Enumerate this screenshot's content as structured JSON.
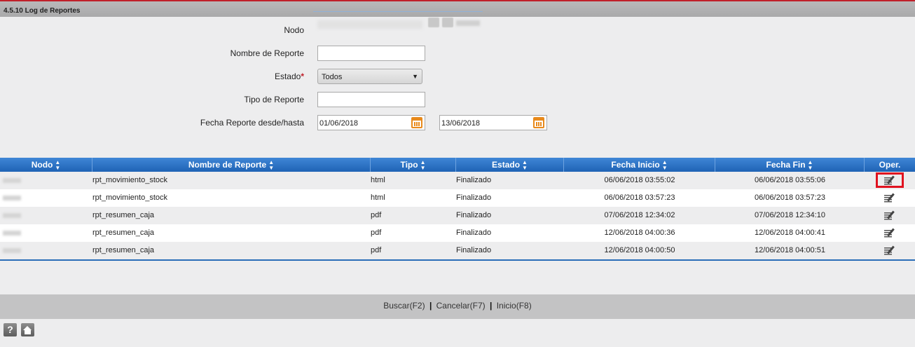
{
  "header": {
    "title": "4.5.10 Log de Reportes"
  },
  "form": {
    "nodo_label": "Nodo",
    "nombre_label": "Nombre de Reporte",
    "nombre_value": "",
    "estado_label": "Estado",
    "estado_required": "*",
    "estado_value": "Todos",
    "tipo_label": "Tipo de Reporte",
    "tipo_value": "",
    "fecha_label": "Fecha Reporte desde/hasta",
    "fecha_desde": "01/06/2018",
    "fecha_hasta": "13/06/2018"
  },
  "grid": {
    "columns": [
      "Nodo",
      "Nombre de Reporte",
      "Tipo",
      "Estado",
      "Fecha Inicio",
      "Fecha Fin",
      "Oper."
    ],
    "rows": [
      {
        "nombre": "rpt_movimiento_stock",
        "tipo": "html",
        "estado": "Finalizado",
        "inicio": "06/06/2018 03:55:02",
        "fin": "06/06/2018 03:55:06"
      },
      {
        "nombre": "rpt_movimiento_stock",
        "tipo": "html",
        "estado": "Finalizado",
        "inicio": "06/06/2018 03:57:23",
        "fin": "06/06/2018 03:57:23"
      },
      {
        "nombre": "rpt_resumen_caja",
        "tipo": "pdf",
        "estado": "Finalizado",
        "inicio": "07/06/2018 12:34:02",
        "fin": "07/06/2018 12:34:10"
      },
      {
        "nombre": "rpt_resumen_caja",
        "tipo": "pdf",
        "estado": "Finalizado",
        "inicio": "12/06/2018 04:00:36",
        "fin": "12/06/2018 04:00:41"
      },
      {
        "nombre": "rpt_resumen_caja",
        "tipo": "pdf",
        "estado": "Finalizado",
        "inicio": "12/06/2018 04:00:50",
        "fin": "12/06/2018 04:00:51"
      }
    ]
  },
  "footer": {
    "buscar": "Buscar(F2)",
    "cancelar": "Cancelar(F7)",
    "inicio": "Inicio(F8)",
    "separator": "|"
  },
  "bottom_icons": {
    "help": "?",
    "help_icon": "question-icon",
    "home_icon": "home-icon"
  },
  "colors": {
    "accent": "#c0202a",
    "grid_header": "#2a6db8",
    "calendar": "#e88a1c",
    "highlight": "#e0121f"
  }
}
